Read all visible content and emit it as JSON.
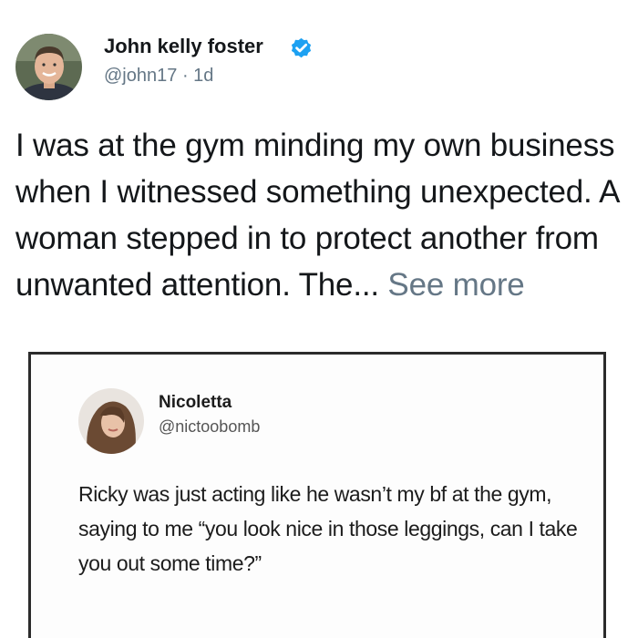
{
  "post": {
    "author_name": "John kelly foster",
    "author_handle": "@john17",
    "separator": "·",
    "age": "1d",
    "avatar_icon": "profile-photo",
    "verified_icon": "verified-badge-icon",
    "verified_color": "#1da1f2",
    "text": "I was at the gym minding my own business when I witnessed something unexpected. A woman stepped in to protect another from unwanted attention. The...",
    "see_more_label": "See more"
  },
  "embedded": {
    "author_name": "Nicoletta",
    "author_handle": "@nictoobomb",
    "avatar_icon": "profile-photo",
    "text": "Ricky was just acting like he wasn’t my bf at the gym, saying to me “you look nice in those leggings, can I take you out some time?”"
  }
}
